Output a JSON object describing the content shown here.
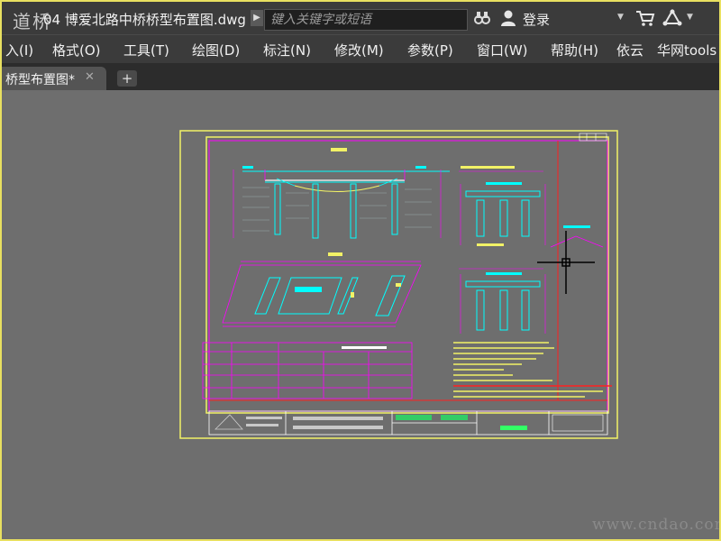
{
  "titlebar": {
    "logo_text": "道桥",
    "doc_title": "04 博爱北路中桥桥型布置图.dwg",
    "search_placeholder": "键入关键字或短语",
    "login_label": "登录"
  },
  "menu": {
    "items": [
      "入(I)",
      "格式(O)",
      "工具(T)",
      "绘图(D)",
      "标注(N)",
      "修改(M)",
      "参数(P)",
      "窗口(W)",
      "帮助(H)",
      "依云",
      "华网tools"
    ]
  },
  "tabs": {
    "active_label": "桥型布置图*",
    "new_tab_symbol": "+"
  },
  "colors": {
    "chrome": "#3b3b3b",
    "canvas": "#6e6e6e",
    "sheet_border": "#f2f266",
    "sheet_frame_red": "#ff2020",
    "magenta": "#ff00ff",
    "cyan": "#00ffff"
  },
  "watermark": "www.cndao.com",
  "icons": [
    "binoculars-icon",
    "user-icon",
    "cart-icon",
    "network-icon"
  ]
}
